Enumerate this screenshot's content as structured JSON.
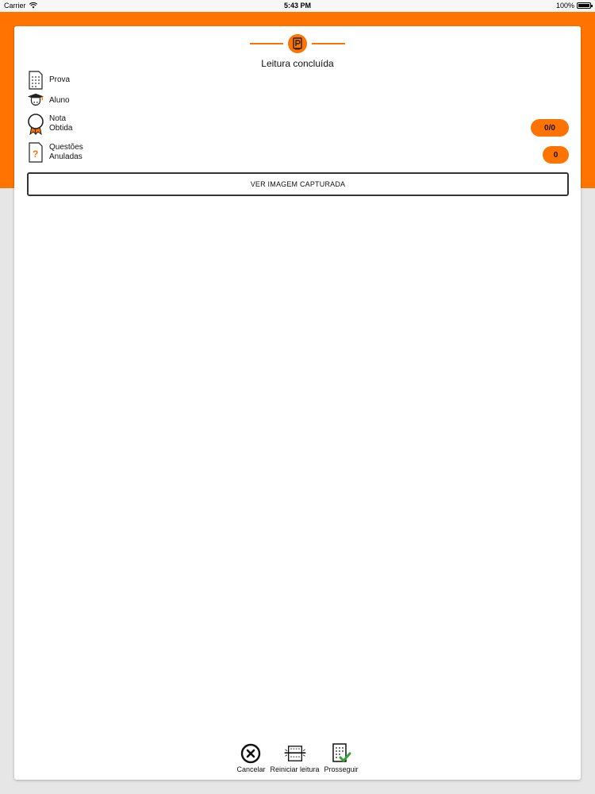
{
  "status_bar": {
    "carrier": "Carrier",
    "time": "5:43 PM",
    "battery": "100%"
  },
  "header": {
    "title": "Leitura concluída"
  },
  "rows": {
    "prova": "Prova",
    "aluno": "Aluno",
    "nota_line1": "Nota",
    "nota_line2": "Obtida",
    "nota_value": "0/0",
    "questoes_line1": "Questões",
    "questoes_line2": "Anuladas",
    "questoes_value": "0"
  },
  "capture_button": "VER IMAGEM CAPTURADA",
  "toolbar": {
    "cancel": "Cancelar",
    "restart": "Reiniciar leitura",
    "proceed": "Prosseguir"
  },
  "colors": {
    "accent": "#ff7400",
    "background": "#e6e6e6",
    "card": "#ffffff"
  },
  "icons": {
    "logo": "logo-icon",
    "prova": "document-grid-icon",
    "aluno": "graduate-icon",
    "nota": "medal-icon",
    "questoes": "question-document-icon",
    "cancel": "close-circle-icon",
    "restart": "scan-icon",
    "proceed": "document-check-icon"
  }
}
